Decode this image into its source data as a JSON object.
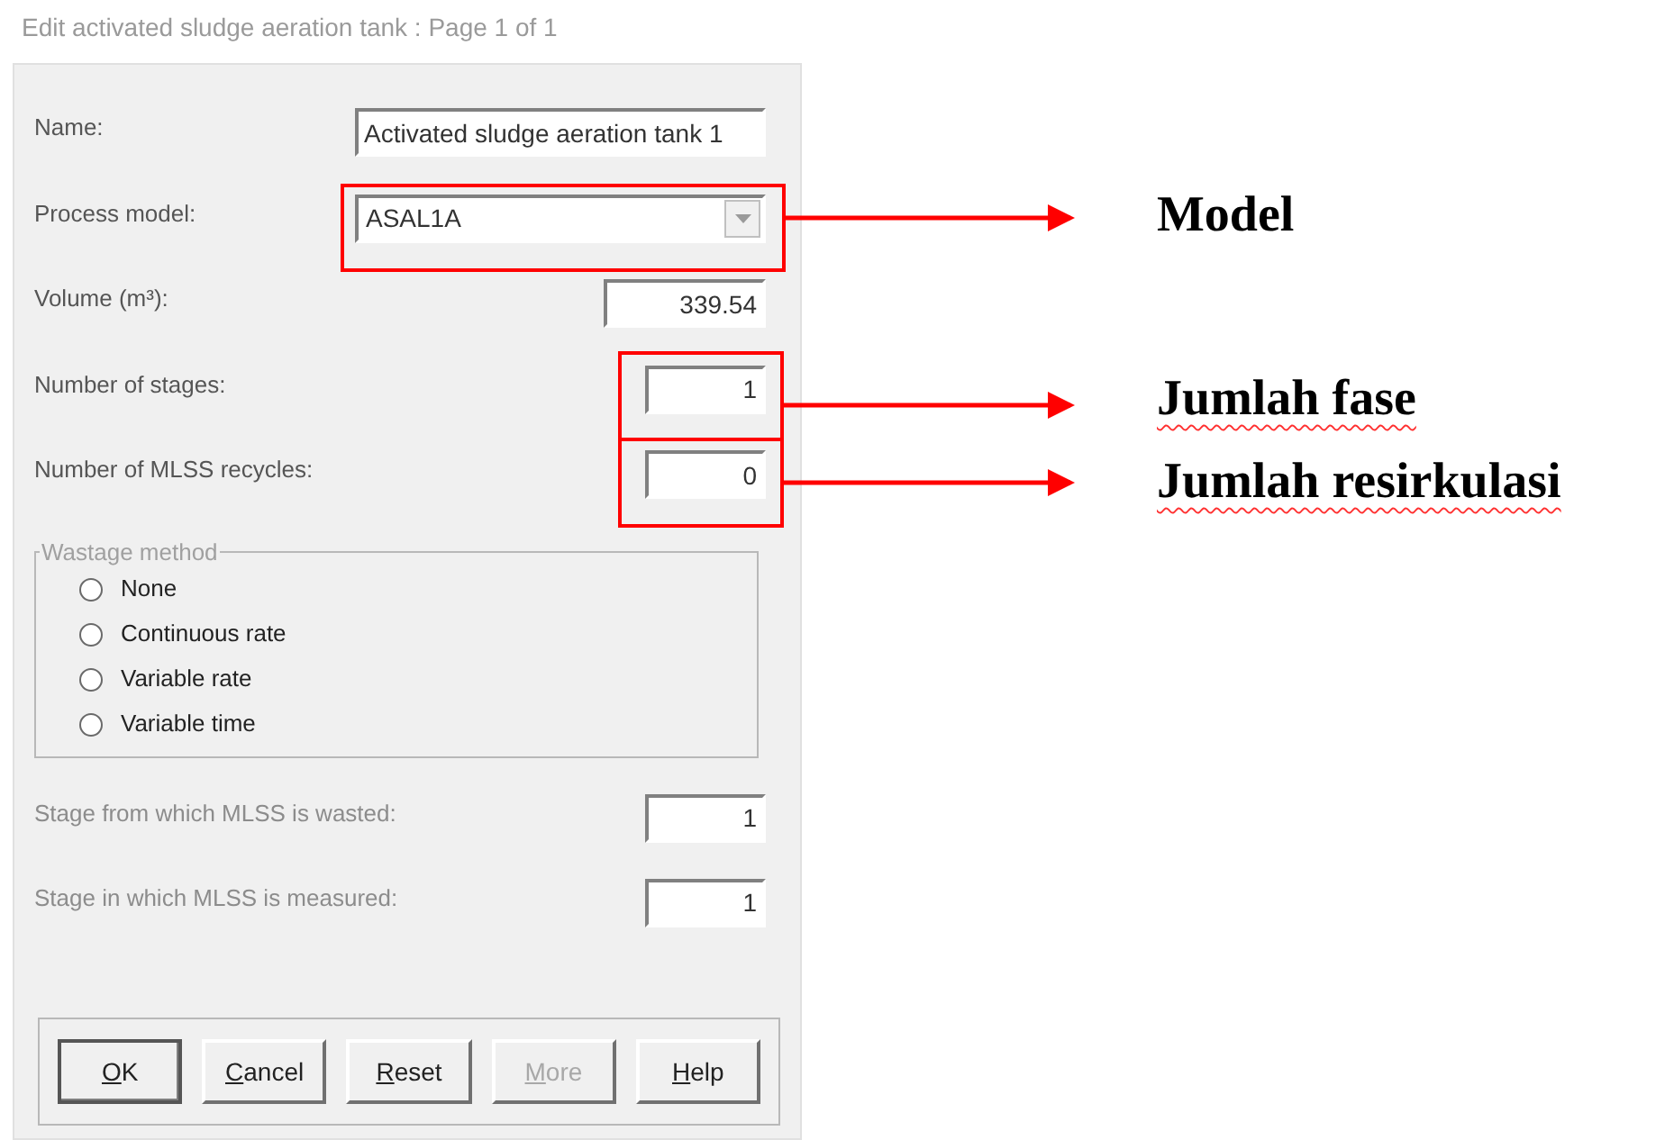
{
  "window": {
    "title": "Edit activated sludge aeration tank : Page 1 of 1"
  },
  "fields_top": [
    {
      "label": "Name:",
      "value": "Activated sludge aeration tank 1",
      "kind": "text",
      "disabled": false
    },
    {
      "label": "Process model:",
      "value": "ASAL1A",
      "kind": "dropdown",
      "disabled": false
    },
    {
      "label": "Volume (m³):",
      "value": "339.54",
      "kind": "decimal",
      "disabled": false
    },
    {
      "label": "Number of stages:",
      "value": "1",
      "kind": "integer",
      "disabled": false
    },
    {
      "label": "Number of MLSS recycles:",
      "value": "0",
      "kind": "integer",
      "disabled": false
    }
  ],
  "wastage_method": {
    "legend": "Wastage method",
    "disabled": true,
    "options": [
      {
        "label": "None",
        "selected": false
      },
      {
        "label": "Continuous rate",
        "selected": false
      },
      {
        "label": "Variable rate",
        "selected": false
      },
      {
        "label": "Variable time",
        "selected": false
      }
    ]
  },
  "fields_bottom": [
    {
      "label": "Stage from which MLSS is wasted:",
      "value": "1",
      "kind": "integer",
      "disabled": true
    },
    {
      "label": "Stage in which MLSS is measured:",
      "value": "1",
      "kind": "integer",
      "disabled": true
    }
  ],
  "buttons": [
    {
      "label": "OK",
      "default": true,
      "disabled": false
    },
    {
      "label": "Cancel",
      "default": false,
      "disabled": false
    },
    {
      "label": "Reset",
      "default": false,
      "disabled": false
    },
    {
      "label": "More",
      "default": false,
      "disabled": true
    },
    {
      "label": "Help",
      "default": false,
      "disabled": false
    }
  ],
  "annotations": [
    {
      "label": "Model",
      "misspelled": false
    },
    {
      "label": "Jumlah fase",
      "misspelled": true
    },
    {
      "label": "Jumlah resirkulasi",
      "misspelled": true
    }
  ]
}
